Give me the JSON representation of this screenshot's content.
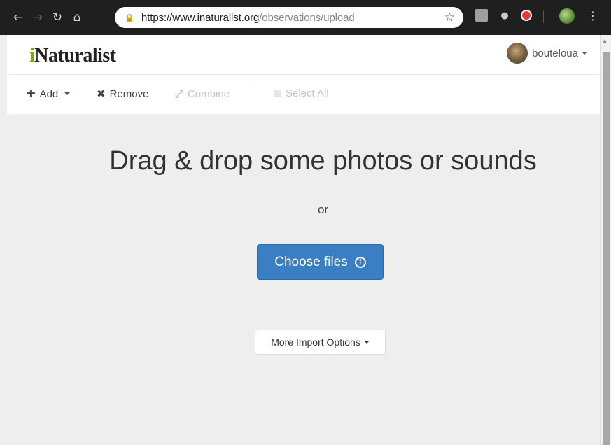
{
  "browser": {
    "url_host": "https://www.inaturalist.org",
    "url_path": "/observations/upload"
  },
  "header": {
    "logo_prefix": "i",
    "logo_rest": "Naturalist",
    "username": "bouteloua"
  },
  "toolbar": {
    "add_label": "Add",
    "remove_label": "Remove",
    "combine_label": "Combine",
    "select_all_label": "Select All"
  },
  "main": {
    "headline": "Drag & drop some photos or sounds",
    "or_text": "or",
    "choose_files_label": "Choose files",
    "more_import_label": "More Import Options"
  },
  "colors": {
    "primary_button": "#3a7fc4",
    "logo_accent": "#74ac00"
  }
}
